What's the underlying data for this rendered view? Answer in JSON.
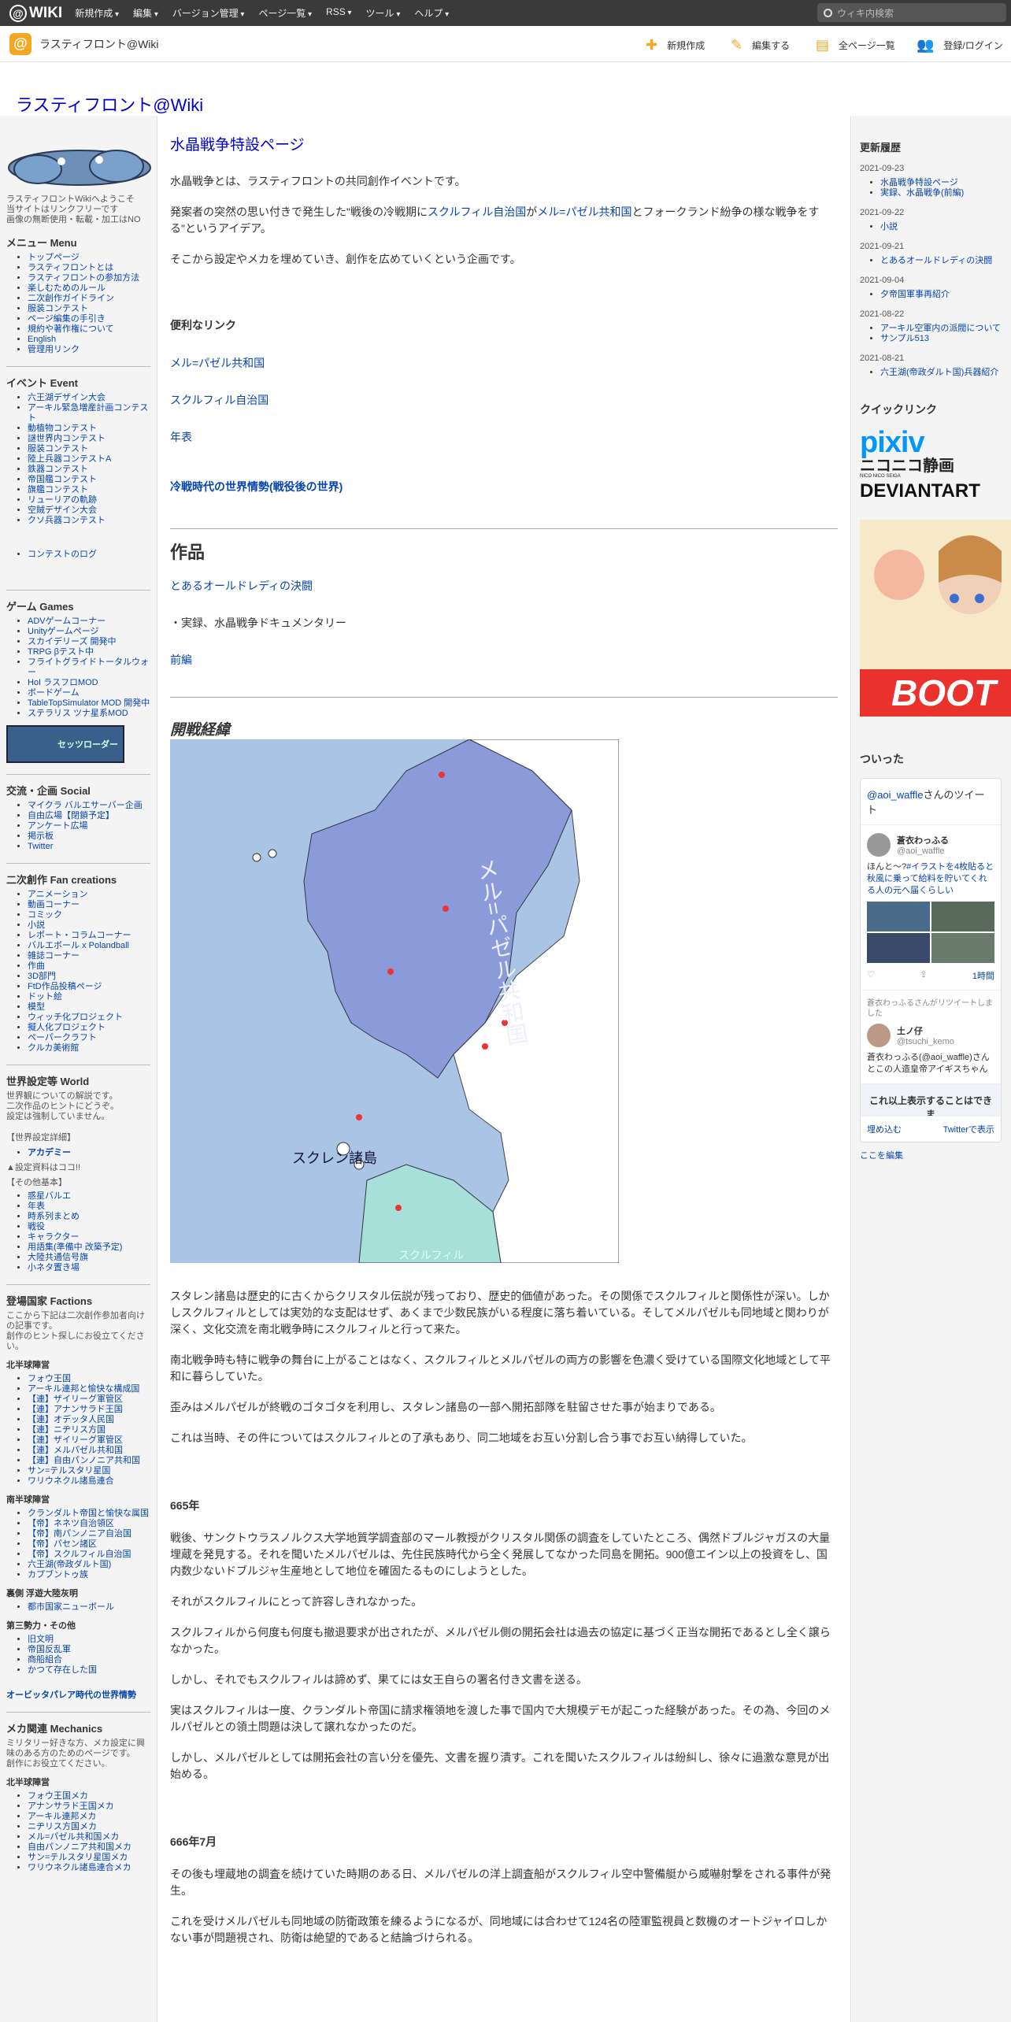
{
  "topbar": {
    "brand": "WIKI",
    "menu": [
      "新規作成",
      "編集",
      "バージョン管理",
      "ページ一覧",
      "RSS",
      "ツール",
      "ヘルプ"
    ],
    "search_placeholder": "ウィキ内検索"
  },
  "subbar": {
    "site_name": "ラスティフロント@Wiki",
    "actions": [
      "新規作成",
      "編集する",
      "全ページ一覧",
      "登録/ログイン"
    ]
  },
  "site_title": "ラスティフロント@Wiki",
  "left": {
    "welcome": [
      "ラスティフロントWikiへようこそ",
      "当サイトはリンクフリーです",
      "画像の無断使用・転載・加工はNO"
    ],
    "menu_title": "メニュー Menu",
    "menu_items": [
      "トップページ",
      "ラスティフロントとは",
      "ラスティフロントの参加方法",
      "楽しむためのルール",
      "二次創作ガイドライン",
      "服装コンテスト",
      "ページ編集の手引き",
      "規約や著作権について",
      "English",
      "管理用リンク"
    ],
    "event_title": "イベント Event",
    "event_items": [
      "六王湖デザイン大会",
      "アーキル緊急増産計画コンテスト",
      "動植物コンテスト",
      "謎世界内コンテスト",
      "服装コンテスト",
      "陸上兵器コンテストA",
      "鉄器コンテスト",
      "帝国艦コンテスト",
      "旗艦コンテスト",
      "リューリアの軌跡",
      "空賊デザイン大会",
      "クソ兵器コンテスト"
    ],
    "event_log": "コンテストのログ",
    "games_title": "ゲーム Games",
    "games_items": [
      "ADVゲームコーナー",
      "Unityゲームページ",
      "スカイデリーズ 開発中",
      "TRPG βテスト中",
      "フライトグライドトータルウォー",
      "HoI ラスフロMOD",
      "ボードゲーム",
      "TableTopSimulator MOD 開発中",
      "ステラリス ツナ星系MOD"
    ],
    "banner_label": "セッツローダー",
    "social_title": "交流・企画 Social",
    "social_items": [
      "マイクラ バルエサーバー企画",
      "自由広場【閉鎖予定】",
      "アンケート広場",
      "掲示板",
      "Twitter"
    ],
    "fan_title": "二次創作 Fan creations",
    "fan_items": [
      "アニメーション",
      "動画コーナー",
      "コミック",
      "小説",
      "レポート・コラムコーナー",
      "バルエボール x Polandball",
      "雑誌コーナー",
      "作曲",
      "3D部門",
      "FtD作品投稿ページ",
      "ドット絵",
      "模型",
      "ウィッチ化プロジェクト",
      "擬人化プロジェクト",
      "ペーパークラフト",
      "クルカ美術館"
    ],
    "world_title": "世界設定等 World",
    "world_desc": [
      "世界観についての解説です。",
      "二次作品のヒントにどうぞ。",
      "設定は強制していません。"
    ],
    "world_detail": "【世界設定詳細】",
    "academy": "アカデミー",
    "settings_note": "▲設定資料はココ!!",
    "other_basics": "【その他基本】",
    "basics_items": [
      "惑星バルエ",
      "年表",
      "時系列まとめ",
      "戦役",
      "キャラクター",
      "用語集(準備中 改築予定)",
      "大陸共通信号旗",
      "小ネタ置き場"
    ],
    "factions_title": "登場国家 Factions",
    "factions_desc": [
      "ここから下記は二次創作参加者向けの記事です。",
      "創作のヒント探しにお役立てください。"
    ],
    "north_title": "北半球陣営",
    "north_items": [
      "フォウ王国",
      "アーキル連邦と愉快な構成国",
      "【連】ザイリーグ軍管区",
      "【連】アナンサラド王国",
      "【連】オデッタ人民国",
      "【連】ニヂリス方国",
      "【連】ザイリーグ軍管区",
      "【連】メルパゼル共和国",
      "【連】自由パンノニア共和国",
      "サン=テルスタリ星国",
      "ワリウネクル諸島連合"
    ],
    "south_title": "南半球陣営",
    "south_items": [
      "クランダルト帝国と愉快な属国",
      "【帝】ネネツ自治領区",
      "【帝】南パンノニア自治国",
      "【帝】パセン諸区",
      "【帝】スクルフィル自治国",
      "六王湖(帝政ダルト国)",
      "カプブントゥ族"
    ],
    "ura_title": "裏側 浮遊大陸灰明",
    "ura_items": [
      "都市国家ニューボール"
    ],
    "third_title": "第三勢力・その他",
    "third_items": [
      "旧文明",
      "帝国反乱軍",
      "商船組合",
      "かつて存在した国"
    ],
    "audit": "オービッタパレア時代の世界情勢",
    "mech_title": "メカ関連 Mechanics",
    "mech_desc": [
      "ミリタリー好きな方、メカ設定に興",
      "味のある方のためのページです。",
      "創作にお役立てください。"
    ],
    "mech_north": "北半球陣営",
    "mech_items": [
      "フォウ王国メカ",
      "アナンサラド王国メカ",
      "アーキル連邦メカ",
      "ニヂリス方国メカ",
      "メル=パゼル共和国メカ",
      "自由パンノニア共和国メカ",
      "サン=テルスタリ星国メカ",
      "ワリウネクル諸島連合メカ"
    ]
  },
  "main": {
    "heading": "水晶戦争特設ページ",
    "intro": "水晶戦争とは、ラスティフロントの共同創作イベントです。",
    "p1_before": "発案者の突然の思い付きで発生した\"戦後の冷戦期に",
    "p1_link1": "スクルフィル自治国",
    "p1_mid": "が",
    "p1_link2": "メル=パゼル共和国",
    "p1_after": "とフォークランド紛争の様な戦争をする\"というアイデア。",
    "p2": "そこから設定やメカを埋めていき、創作を広めていくという企画です。",
    "links_heading": "便利なリンク",
    "link_melpazel": "メル=パゼル共和国",
    "link_skrufil": "スクルフィル自治国",
    "link_chronology": "年表",
    "link_world": "冷戦時代の世界情勢(戦役後の世界)",
    "works_heading": "作品",
    "work1": "とあるオールドレディの決闘",
    "work2": "・実録、水晶戦争ドキュメンタリー",
    "work3": "前編",
    "war_heading": "開戦経緯",
    "map_label_republic": "メル=パゼル共和国",
    "map_label_islands": "スクレン諸島",
    "map_label_south": "スクルフィル",
    "para_a": "スタレン諸島は歴史的に古くからクリスタル伝説が残っており、歴史的価値があった。その関係でスクルフィルと関係性が深い。しかしスクルフィルとしては実効的な支配はせず、あくまで少数民族がいる程度に落ち着いている。そしてメルパゼルも同地域と関わりが深く、文化交流を南北戦争時にスクルフィルと行って来た。",
    "para_b": "南北戦争時も特に戦争の舞台に上がることはなく、スクルフィルとメルパゼルの両方の影響を色濃く受けている国際文化地域として平和に暮らしていた。",
    "para_c": "歪みはメルパゼルが終戦のゴタゴタを利用し、スタレン諸島の一部へ開拓部隊を駐留させた事が始まりである。",
    "para_d": "これは当時、その件についてはスクルフィルとの了承もあり、同二地域をお互い分割し合う事でお互い納得していた。",
    "year_665": "665年",
    "para_e": "戦後、サンクトウラスノルクス大学地質学調査部のマール教授がクリスタル関係の調査をしていたところ、偶然ドブルジャガスの大量埋蔵を発見する。それを聞いたメルパゼルは、先住民族時代から全く発展してなかった同島を開拓。900億エイン以上の投資をし、国内数少ないドブルジャ生産地として地位を確固たるものにしようとした。",
    "para_f": "それがスクルフィルにとって許容しきれなかった。",
    "para_g": "スクルフィルから何度も何度も撤退要求が出されたが、メルパゼル側の開拓会社は過去の協定に基づく正当な開拓であるとし全く譲らなかった。",
    "para_h": "しかし、それでもスクルフィルは諦めず、果てには女王自らの署名付き文書を送る。",
    "para_i": "実はスクルフィルは一度、クランダルト帝国に請求権領地を渡した事で国内で大規模デモが起こった経験があった。その為、今回のメルパゼルとの領土問題は決して譲れなかったのだ。",
    "para_j": "しかし、メルパゼルとしては開拓会社の言い分を優先、文書を握り潰す。これを聞いたスクルフィルは紛糾し、徐々に過激な意見が出始める。",
    "year_666": "666年7月",
    "para_k": "その後も埋蔵地の調査を続けていた時期のある日、メルパゼルの洋上調査船がスクルフィル空中警備艇から威嚇射撃をされる事件が発生。",
    "para_l": "これを受けメルパゼルも同地域の防衛政策を練るようになるが、同地域には合わせて124名の陸軍監視員と数機のオートジャイロしかない事が問題視され、防衛は絶望的であると結論づけられる。"
  },
  "right": {
    "history_title": "更新履歴",
    "history": [
      {
        "date": "2021-09-23",
        "items": [
          "水晶戦争特設ページ",
          "実録、水晶戦争(前編)"
        ]
      },
      {
        "date": "2021-09-22",
        "items": [
          "小説"
        ]
      },
      {
        "date": "2021-09-21",
        "items": [
          "とあるオールドレディの決闘"
        ]
      },
      {
        "date": "2021-09-04",
        "items": [
          "夕帝国軍事再紹介"
        ]
      },
      {
        "date": "2021-08-22",
        "items": [
          "アーキル空軍内の派閥について",
          "サンプル513"
        ]
      },
      {
        "date": "2021-08-21",
        "items": [
          "六王湖(帝政ダルト国)兵器紹介"
        ]
      }
    ],
    "quick_title": "クイックリンク",
    "pixiv": "pixiv",
    "nico": "ニコニコ静画",
    "nico_sub": "NICO NICO SEIGA",
    "deviant": "DEVIANTART",
    "booth": "BOOT",
    "twitter_title": "ついった",
    "tw_head_user": "@aoi_waffle",
    "tw_head_suffix": "さんのツイート",
    "tw1_name": "蒼衣わっふる",
    "tw1_handle": "@aoi_waffle",
    "tw1_text_a": "ほんと～?",
    "tw1_text_b": "#イラストを4枚貼ると秋風に乗って給料を貯いてくれる人の元へ届くらしい",
    "tw1_time": "1時間",
    "rt_note": "蒼衣わっふるさんがリツイートしました",
    "tw2_name": "土ノ仔",
    "tw2_handle": "@tsuchi_kemo",
    "tw2_text": "蒼衣わっふる(@aoi_waffle)さんとこの人造皇帝アイギスちゃん",
    "show_more": "これ以上表示することはできま",
    "embed": "埋め込む",
    "view_on_twitter": "Twitterで表示",
    "edit_here": "ここを編集"
  }
}
